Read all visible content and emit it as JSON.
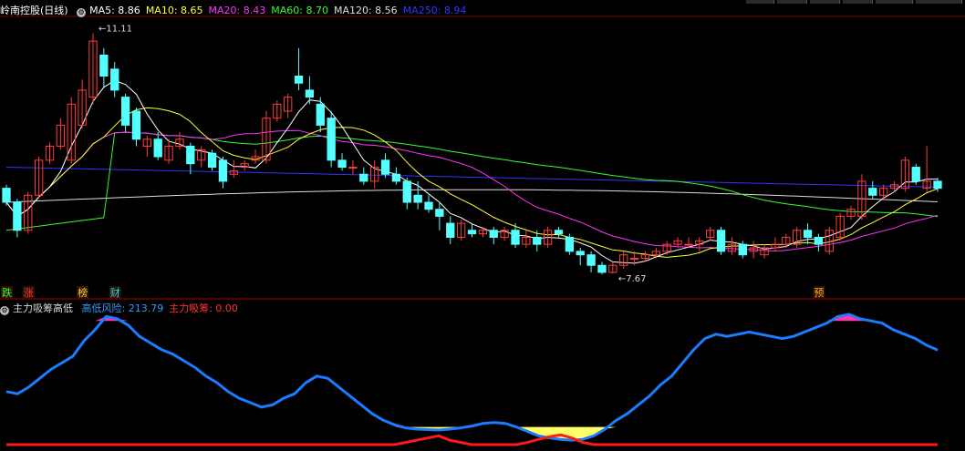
{
  "header": {
    "stock_name": "岭南控股",
    "period": "(日线)",
    "ma": [
      {
        "label": "MA5",
        "value": "8.86",
        "color": "#ffffff"
      },
      {
        "label": "MA10",
        "value": "8.65",
        "color": "#ffff33"
      },
      {
        "label": "MA20",
        "value": "8.43",
        "color": "#ff33ff"
      },
      {
        "label": "MA60",
        "value": "8.70",
        "color": "#33ff33"
      },
      {
        "label": "MA120",
        "value": "8.56",
        "color": "#dddddd"
      },
      {
        "label": "MA250",
        "value": "8.94",
        "color": "#3333ff"
      }
    ]
  },
  "indicator_header": {
    "name": "主力吸筹高低",
    "items": [
      {
        "label": "高低风险",
        "value": "213.79",
        "color": "#3399ff"
      },
      {
        "label": "主力吸筹",
        "value": "0.00",
        "color": "#ff3333"
      }
    ]
  },
  "chart_data": [
    {
      "type": "candlestick",
      "ylim": [
        7.4,
        11.3
      ],
      "annotations": [
        {
          "text": "11.11",
          "x": 8,
          "value": 11.11
        },
        {
          "text": "7.67",
          "x": 56,
          "value": 7.67
        }
      ],
      "markers": [
        {
          "text": "跌",
          "x": 0,
          "color": "#33ff33"
        },
        {
          "text": "涨",
          "x": 2,
          "color": "#ff3333"
        },
        {
          "text": "榜",
          "x": 7,
          "color": "#ffcc33"
        },
        {
          "text": "财",
          "x": 10,
          "color": "#33ccff"
        },
        {
          "text": "预",
          "x": 75,
          "color": "#ffaa33"
        }
      ],
      "candles": [
        [
          8.9,
          8.7,
          8.95,
          8.65
        ],
        [
          8.7,
          8.3,
          8.75,
          8.2
        ],
        [
          8.3,
          8.8,
          8.85,
          8.25
        ],
        [
          8.8,
          9.3,
          9.35,
          8.75
        ],
        [
          9.3,
          9.5,
          9.55,
          9.25
        ],
        [
          9.5,
          9.8,
          9.9,
          9.45
        ],
        [
          9.3,
          10.1,
          10.2,
          9.25
        ],
        [
          9.8,
          10.3,
          10.45,
          9.75
        ],
        [
          10.2,
          11.0,
          11.11,
          10.1
        ],
        [
          10.8,
          10.5,
          10.9,
          10.35
        ],
        [
          10.6,
          10.3,
          10.7,
          10.2
        ],
        [
          10.2,
          9.8,
          10.25,
          9.7
        ],
        [
          10.0,
          9.6,
          10.05,
          9.5
        ],
        [
          9.5,
          9.6,
          9.65,
          9.35
        ],
        [
          9.6,
          9.35,
          9.7,
          9.3
        ],
        [
          9.3,
          9.5,
          9.6,
          9.25
        ],
        [
          9.5,
          9.6,
          9.7,
          9.45
        ],
        [
          9.5,
          9.25,
          9.55,
          9.1
        ],
        [
          9.3,
          9.45,
          9.5,
          9.2
        ],
        [
          9.4,
          9.2,
          9.45,
          9.15
        ],
        [
          9.3,
          9.0,
          9.35,
          8.9
        ],
        [
          9.1,
          9.15,
          9.3,
          9.05
        ],
        [
          9.2,
          9.25,
          9.3,
          9.15
        ],
        [
          9.3,
          9.35,
          9.45,
          9.25
        ],
        [
          9.3,
          9.9,
          10.0,
          9.25
        ],
        [
          9.9,
          10.1,
          10.15,
          9.85
        ],
        [
          10.0,
          10.2,
          10.25,
          9.9
        ],
        [
          10.5,
          10.4,
          10.9,
          10.3
        ],
        [
          10.3,
          10.2,
          10.5,
          10.1
        ],
        [
          10.1,
          9.8,
          10.2,
          9.7
        ],
        [
          9.9,
          9.3,
          10.0,
          9.2
        ],
        [
          9.3,
          9.2,
          9.4,
          9.15
        ],
        [
          9.2,
          9.2,
          9.3,
          9.1
        ],
        [
          9.1,
          9.0,
          9.2,
          8.95
        ],
        [
          9.0,
          9.2,
          9.3,
          8.9
        ],
        [
          9.3,
          9.1,
          9.4,
          9.05
        ],
        [
          9.1,
          9.0,
          9.2,
          8.95
        ],
        [
          9.0,
          8.7,
          9.05,
          8.6
        ],
        [
          8.8,
          8.7,
          9.0,
          8.6
        ],
        [
          8.7,
          8.6,
          8.8,
          8.55
        ],
        [
          8.6,
          8.5,
          8.7,
          8.3
        ],
        [
          8.4,
          8.2,
          8.5,
          8.1
        ],
        [
          8.2,
          8.4,
          8.45,
          8.15
        ],
        [
          8.3,
          8.25,
          8.4,
          8.2
        ],
        [
          8.25,
          8.3,
          8.35,
          8.2
        ],
        [
          8.3,
          8.2,
          8.35,
          8.1
        ],
        [
          8.2,
          8.3,
          8.35,
          8.15
        ],
        [
          8.3,
          8.1,
          8.4,
          8.05
        ],
        [
          8.1,
          8.2,
          8.3,
          8.05
        ],
        [
          8.2,
          8.1,
          8.3,
          8.0
        ],
        [
          8.1,
          8.3,
          8.35,
          8.05
        ],
        [
          8.3,
          8.25,
          8.35,
          8.2
        ],
        [
          8.2,
          8.0,
          8.25,
          7.95
        ],
        [
          8.0,
          7.95,
          8.05,
          7.8
        ],
        [
          7.95,
          7.8,
          8.0,
          7.7
        ],
        [
          7.8,
          7.7,
          7.85,
          7.67
        ],
        [
          7.7,
          7.8,
          7.85,
          7.68
        ],
        [
          7.8,
          7.95,
          8.0,
          7.75
        ],
        [
          7.9,
          7.9,
          8.0,
          7.8
        ],
        [
          7.9,
          7.95,
          8.0,
          7.85
        ],
        [
          7.95,
          8.0,
          8.05,
          7.9
        ],
        [
          8.0,
          8.1,
          8.15,
          7.95
        ],
        [
          8.1,
          8.15,
          8.2,
          8.05
        ],
        [
          8.1,
          8.1,
          8.2,
          8.05
        ],
        [
          8.1,
          8.15,
          8.2,
          8.0
        ],
        [
          8.2,
          8.3,
          8.35,
          8.15
        ],
        [
          8.3,
          8.0,
          8.35,
          7.95
        ],
        [
          8.0,
          8.1,
          8.2,
          7.95
        ],
        [
          8.1,
          7.95,
          8.15,
          7.9
        ],
        [
          8.0,
          8.05,
          8.15,
          7.9
        ],
        [
          7.95,
          8.05,
          8.1,
          7.9
        ],
        [
          8.05,
          8.1,
          8.2,
          8.0
        ],
        [
          8.1,
          8.2,
          8.25,
          8.05
        ],
        [
          8.1,
          8.3,
          8.35,
          8.05
        ],
        [
          8.3,
          8.2,
          8.4,
          8.1
        ],
        [
          8.2,
          8.1,
          8.25,
          8.0
        ],
        [
          8.0,
          8.3,
          8.35,
          7.95
        ],
        [
          8.2,
          8.5,
          8.55,
          8.15
        ],
        [
          8.5,
          8.6,
          8.65,
          8.45
        ],
        [
          8.5,
          9.0,
          9.1,
          8.45
        ],
        [
          8.9,
          8.8,
          9.0,
          8.75
        ],
        [
          8.8,
          8.9,
          8.95,
          8.75
        ],
        [
          8.9,
          8.95,
          9.0,
          8.85
        ],
        [
          8.9,
          9.3,
          9.35,
          8.85
        ],
        [
          9.2,
          9.0,
          9.25,
          8.95
        ],
        [
          8.9,
          9.0,
          9.5,
          8.85
        ],
        [
          9.0,
          8.9,
          9.05,
          8.85
        ]
      ]
    },
    {
      "type": "line",
      "ylim": [
        0,
        330
      ],
      "series": [
        {
          "name": "高低风险",
          "color": "#1a7cff",
          "values": [
            120,
            115,
            130,
            150,
            170,
            185,
            200,
            235,
            260,
            290,
            285,
            270,
            245,
            230,
            215,
            205,
            190,
            175,
            155,
            140,
            120,
            105,
            95,
            85,
            90,
            105,
            115,
            140,
            155,
            150,
            130,
            110,
            90,
            70,
            55,
            45,
            38,
            35,
            34,
            33,
            35,
            38,
            42,
            48,
            50,
            48,
            40,
            30,
            20,
            15,
            12,
            10,
            12,
            20,
            35,
            55,
            70,
            90,
            110,
            135,
            155,
            185,
            215,
            240,
            250,
            245,
            250,
            255,
            250,
            245,
            240,
            245,
            255,
            265,
            275,
            290,
            295,
            285,
            280,
            275,
            260,
            250,
            240,
            225,
            214
          ]
        },
        {
          "name": "主力吸筹",
          "color": "#ff1a1a",
          "values": [
            0,
            0,
            0,
            0,
            0,
            0,
            0,
            0,
            0,
            0,
            0,
            0,
            0,
            0,
            0,
            0,
            0,
            0,
            0,
            0,
            0,
            0,
            0,
            0,
            0,
            0,
            0,
            0,
            0,
            0,
            0,
            0,
            0,
            0,
            0,
            0,
            5,
            10,
            15,
            20,
            10,
            5,
            0,
            0,
            0,
            0,
            0,
            5,
            12,
            18,
            22,
            15,
            5,
            0,
            0,
            0,
            0,
            0,
            0,
            0,
            0,
            0,
            0,
            0,
            0,
            0,
            0,
            0,
            0,
            0,
            0,
            0,
            0,
            0,
            0,
            0,
            0,
            0,
            0,
            0,
            0,
            0,
            0,
            0,
            0
          ]
        }
      ]
    }
  ]
}
